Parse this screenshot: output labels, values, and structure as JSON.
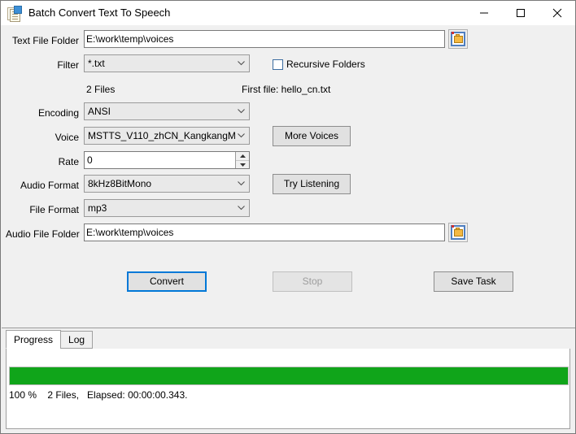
{
  "window": {
    "title": "Batch Convert Text To Speech",
    "icon": "documents-icon",
    "controls": {
      "minimize": "minimize-icon",
      "maximize": "maximize-icon",
      "close": "close-icon"
    }
  },
  "form": {
    "text_file_folder": {
      "label": "Text File Folder",
      "value": "E:\\work\\temp\\voices",
      "browse_icon": "folder-icon"
    },
    "filter": {
      "label": "Filter",
      "value": "*.txt"
    },
    "recursive": {
      "label": "Recursive Folders",
      "checked": false
    },
    "file_count": "2 Files",
    "first_file": "First file: hello_cn.txt",
    "encoding": {
      "label": "Encoding",
      "value": "ANSI"
    },
    "voice": {
      "label": "Voice",
      "value": "MSTTS_V110_zhCN_KangkangM"
    },
    "more_voices": "More Voices",
    "rate": {
      "label": "Rate",
      "value": "0"
    },
    "audio_format": {
      "label": "Audio Format",
      "value": "8kHz8BitMono"
    },
    "try_listening": "Try Listening",
    "file_format": {
      "label": "File Format",
      "value": "mp3"
    },
    "audio_file_folder": {
      "label": "Audio File Folder",
      "value": "E:\\work\\temp\\voices",
      "browse_icon": "folder-icon"
    }
  },
  "actions": {
    "convert": "Convert",
    "stop": "Stop",
    "save_task": "Save Task"
  },
  "tabs": [
    {
      "label": "Progress",
      "active": true
    },
    {
      "label": "Log",
      "active": false
    }
  ],
  "progress": {
    "percent": 100,
    "fill_color": "#10a51a",
    "status": "100 %    2 Files,   Elapsed: 00:00:00.343."
  },
  "colors": {
    "accent": "#0078d7",
    "window_bg": "#f0f0f0",
    "progress_green": "#10a51a"
  }
}
